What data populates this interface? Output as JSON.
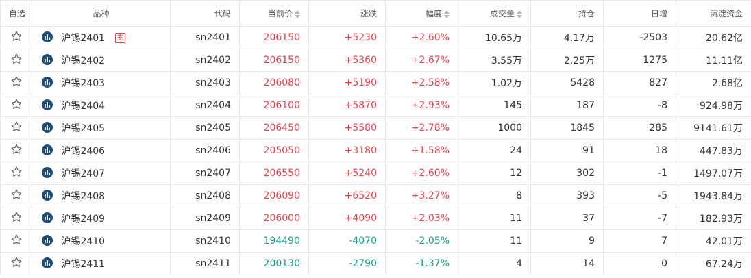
{
  "colors": {
    "up": "#e0454f",
    "down": "#16a085",
    "icon": "#1f4e79",
    "border": "#e6e8eb"
  },
  "header": {
    "fav": "自选",
    "name": "品种",
    "code": "代码",
    "price": "当前价",
    "change": "涨跌",
    "pct": "幅度",
    "volume": "成交量",
    "oi": "持仓",
    "daily": "日增",
    "funds": "沉淀资金"
  },
  "main_tag": "主",
  "rows": [
    {
      "name": "沪锡2401",
      "code": "sn2401",
      "price": "206150",
      "change": "+5230",
      "pct": "+2.60%",
      "volume": "10.65万",
      "oi": "4.17万",
      "daily": "-2503",
      "funds": "20.62亿",
      "dir": "up",
      "main": true
    },
    {
      "name": "沪锡2402",
      "code": "sn2402",
      "price": "206150",
      "change": "+5360",
      "pct": "+2.67%",
      "volume": "3.55万",
      "oi": "2.25万",
      "daily": "1275",
      "funds": "11.11亿",
      "dir": "up",
      "main": false
    },
    {
      "name": "沪锡2403",
      "code": "sn2403",
      "price": "206080",
      "change": "+5190",
      "pct": "+2.58%",
      "volume": "1.02万",
      "oi": "5428",
      "daily": "827",
      "funds": "2.68亿",
      "dir": "up",
      "main": false
    },
    {
      "name": "沪锡2404",
      "code": "sn2404",
      "price": "206100",
      "change": "+5870",
      "pct": "+2.93%",
      "volume": "145",
      "oi": "187",
      "daily": "-8",
      "funds": "924.98万",
      "dir": "up",
      "main": false
    },
    {
      "name": "沪锡2405",
      "code": "sn2405",
      "price": "206450",
      "change": "+5580",
      "pct": "+2.78%",
      "volume": "1000",
      "oi": "1845",
      "daily": "285",
      "funds": "9141.61万",
      "dir": "up",
      "main": false
    },
    {
      "name": "沪锡2406",
      "code": "sn2406",
      "price": "205050",
      "change": "+3180",
      "pct": "+1.58%",
      "volume": "24",
      "oi": "91",
      "daily": "18",
      "funds": "447.83万",
      "dir": "up",
      "main": false
    },
    {
      "name": "沪锡2407",
      "code": "sn2407",
      "price": "206550",
      "change": "+5240",
      "pct": "+2.60%",
      "volume": "12",
      "oi": "302",
      "daily": "-1",
      "funds": "1497.07万",
      "dir": "up",
      "main": false
    },
    {
      "name": "沪锡2408",
      "code": "sn2408",
      "price": "206090",
      "change": "+6520",
      "pct": "+3.27%",
      "volume": "8",
      "oi": "393",
      "daily": "-5",
      "funds": "1943.84万",
      "dir": "up",
      "main": false
    },
    {
      "name": "沪锡2409",
      "code": "sn2409",
      "price": "206000",
      "change": "+4090",
      "pct": "+2.03%",
      "volume": "11",
      "oi": "37",
      "daily": "-7",
      "funds": "182.93万",
      "dir": "up",
      "main": false
    },
    {
      "name": "沪锡2410",
      "code": "sn2410",
      "price": "194490",
      "change": "-4070",
      "pct": "-2.05%",
      "volume": "11",
      "oi": "9",
      "daily": "7",
      "funds": "42.01万",
      "dir": "down",
      "main": false
    },
    {
      "name": "沪锡2411",
      "code": "sn2411",
      "price": "200130",
      "change": "-2790",
      "pct": "-1.37%",
      "volume": "4",
      "oi": "14",
      "daily": "0",
      "funds": "67.24万",
      "dir": "down",
      "main": false
    }
  ]
}
